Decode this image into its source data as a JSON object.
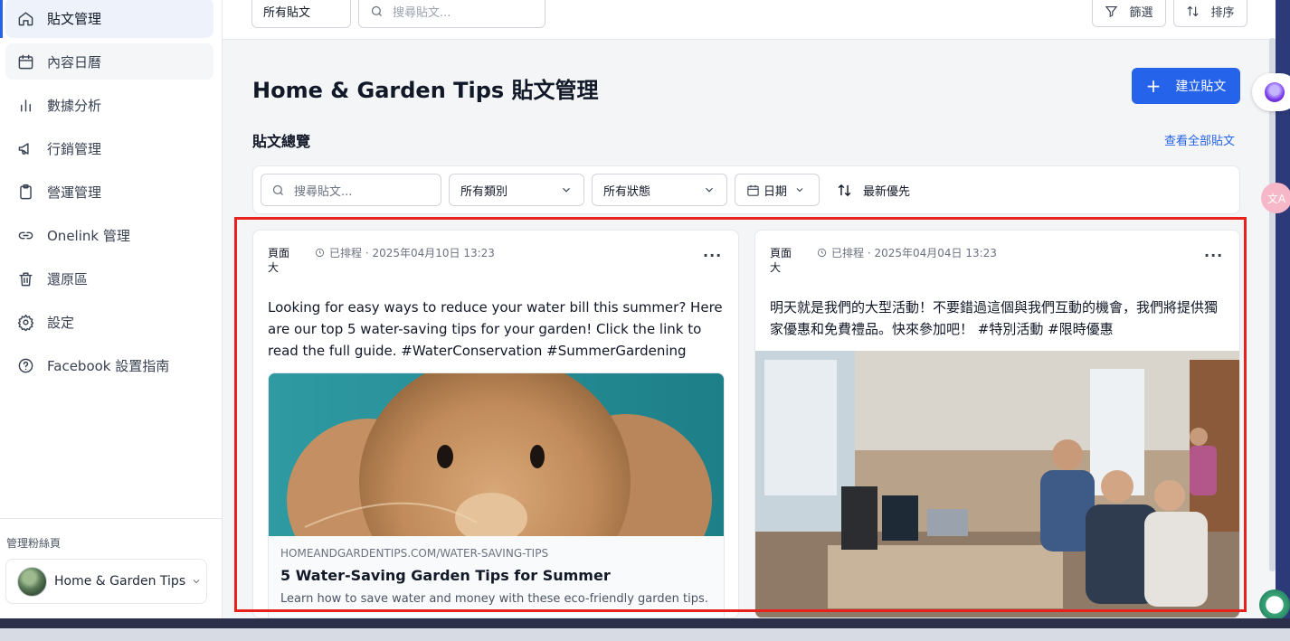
{
  "sidebar": {
    "items": [
      {
        "label": "貼文管理",
        "icon": "home-icon",
        "active": true
      },
      {
        "label": "內容日曆",
        "icon": "calendar-icon"
      },
      {
        "label": "數據分析",
        "icon": "bar-chart-icon"
      },
      {
        "label": "行銷管理",
        "icon": "megaphone-icon"
      },
      {
        "label": "營運管理",
        "icon": "clipboard-icon"
      },
      {
        "label": "Onelink 管理",
        "icon": "link-icon"
      },
      {
        "label": "還原區",
        "icon": "trash-icon"
      },
      {
        "label": "設定",
        "icon": "gear-icon"
      },
      {
        "label": "Facebook 設置指南",
        "icon": "help-circle-icon"
      }
    ],
    "fans_label": "管理粉絲頁",
    "page_name": "Home & Garden Tips"
  },
  "topbar": {
    "select_value": "所有貼文",
    "search_placeholder": "搜尋貼文...",
    "filter_label": "篩選",
    "sort_label": "排序"
  },
  "main": {
    "title": "Home & Garden Tips 貼文管理",
    "create_label": "建立貼文",
    "section_title": "貼文總覽",
    "view_all": "查看全部貼文"
  },
  "filters": {
    "search_placeholder": "搜尋貼文...",
    "category": "所有類別",
    "status": "所有狀態",
    "date": "日期",
    "sort": "最新優先"
  },
  "posts": [
    {
      "avatar_alt": "頁面大",
      "status": "已排程 · 2025年04月10日 13:23",
      "more": "···",
      "text": "Looking for easy ways to reduce your water bill this summer? Here are our top 5 water-saving tips for your garden! Click the link to read the full guide. #WaterConservation #SummerGardening",
      "link": {
        "domain": "HOMEANDGARDENTIPS.COM/WATER-SAVING-TIPS",
        "title": "5 Water-Saving Garden Tips for Summer",
        "description": "Learn how to save water and money with these eco-friendly garden tips."
      }
    },
    {
      "avatar_alt": "頁面大",
      "status": "已排程 · 2025年04月04日 13:23",
      "more": "···",
      "text": "明天就是我們的大型活動！不要錯過這個與我們互動的機會，我們將提供獨家優惠和免費禮品。快來參加吧！ #特別活動 #限時優惠"
    }
  ],
  "colors": {
    "accent": "#2563eb",
    "highlight": "#e8211c"
  }
}
